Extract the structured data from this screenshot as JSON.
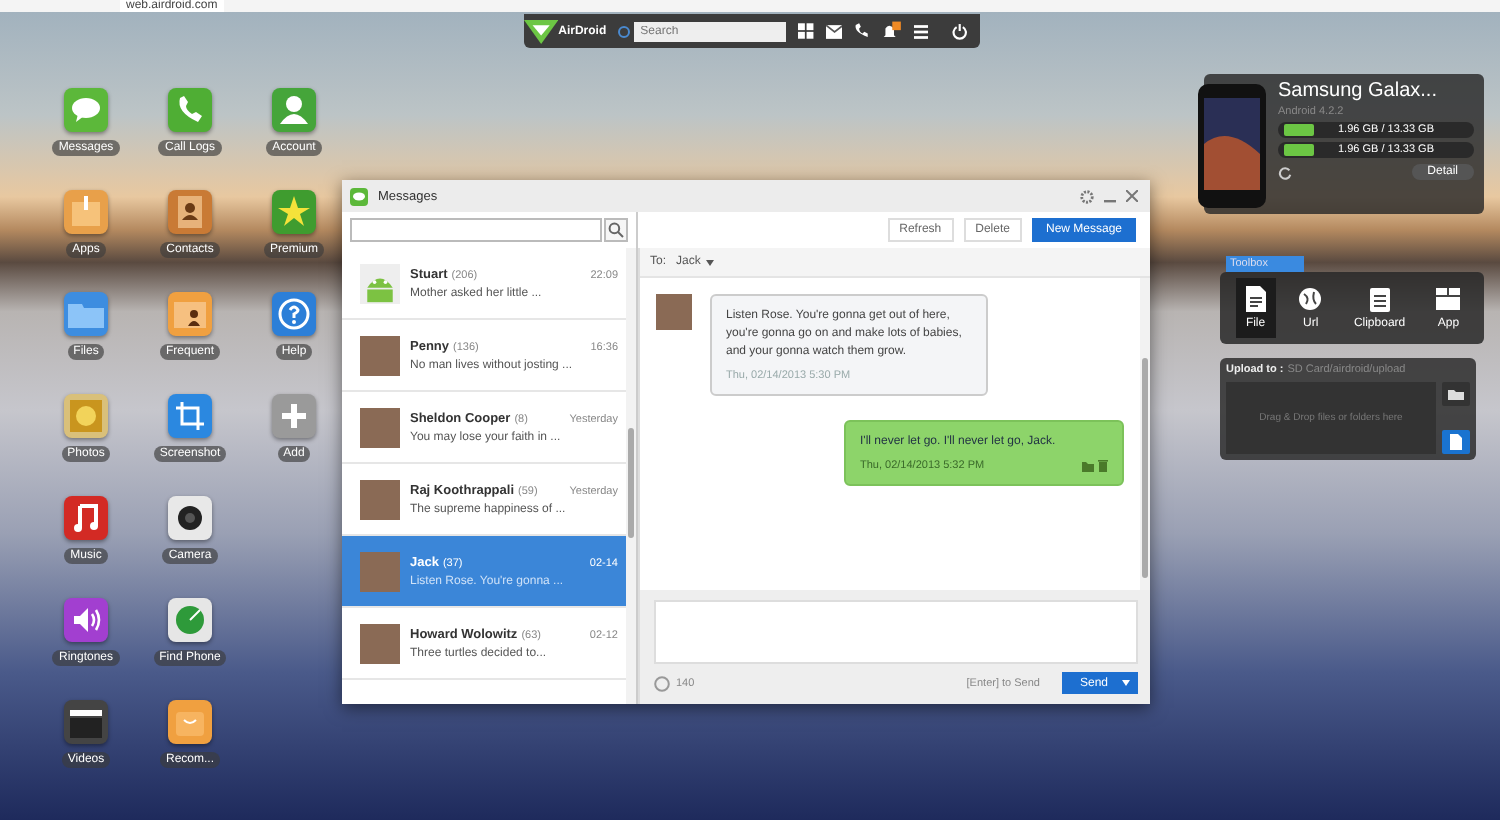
{
  "browser": {
    "url": "web.airdroid.com"
  },
  "top_bar": {
    "logo": "AirDroid",
    "search": {
      "placeholder": "Search"
    }
  },
  "desktop_icons": [
    {
      "label": "Messages",
      "kind": "messages"
    },
    {
      "label": "Apps",
      "kind": "apps"
    },
    {
      "label": "Files",
      "kind": "files"
    },
    {
      "label": "Photos",
      "kind": "photos"
    },
    {
      "label": "Music",
      "kind": "music"
    },
    {
      "label": "Ringtones",
      "kind": "ringtones"
    },
    {
      "label": "Videos",
      "kind": "videos"
    },
    {
      "label": "Call Logs",
      "kind": "calls"
    },
    {
      "label": "Contacts",
      "kind": "contacts"
    },
    {
      "label": "Frequent",
      "kind": "frequent"
    },
    {
      "label": "Screenshot",
      "kind": "screenshot"
    },
    {
      "label": "Camera",
      "kind": "camera"
    },
    {
      "label": "Find Phone",
      "kind": "findphone"
    },
    {
      "label": "Recom...",
      "kind": "recommend"
    },
    {
      "label": "Account",
      "kind": "account"
    },
    {
      "label": "Premium",
      "kind": "premium"
    },
    {
      "label": "Help",
      "kind": "help"
    },
    {
      "label": "Add",
      "kind": "add"
    }
  ],
  "messages_window": {
    "title": "Messages",
    "toolbar": [
      {
        "label": "Refresh",
        "primary": false
      },
      {
        "label": "Delete",
        "primary": false
      },
      {
        "label": "New Message",
        "primary": true
      }
    ],
    "conversations": [
      {
        "name": "Stuart",
        "count": "(206)",
        "time": "22:09",
        "preview": "Mother asked her little ...",
        "kind": "android",
        "selected": false
      },
      {
        "name": "Penny",
        "count": "(136)",
        "time": "16:36",
        "preview": "No man lives without josting ...",
        "kind": "photo",
        "selected": false
      },
      {
        "name": "Sheldon Cooper",
        "count": "(8)",
        "time": "Yesterday",
        "preview": "You may lose your faith in ...",
        "kind": "photo",
        "selected": false
      },
      {
        "name": "Raj Koothrappali",
        "count": "(59)",
        "time": "Yesterday",
        "preview": "The supreme happiness of ...",
        "kind": "photo",
        "selected": false
      },
      {
        "name": "Jack",
        "count": "(37)",
        "time": "02-14",
        "preview": "Listen Rose. You're gonna ...",
        "kind": "photo",
        "selected": true
      },
      {
        "name": "Howard Wolowitz",
        "count": "(63)",
        "time": "02-12",
        "preview": "Three turtles decided to...",
        "kind": "photo",
        "selected": false
      }
    ],
    "chat": {
      "to_label": "To:",
      "recipient": "Jack",
      "messages": [
        {
          "kind": "incoming",
          "text": "Listen Rose. You're gonna get out of here, you're gonna go on and make lots of babies, and your gonna watch them grow.",
          "time": "Thu, 02/14/2013 5:30 PM"
        },
        {
          "kind": "outgoing",
          "text": "I'll never let go. I'll never let go, Jack.",
          "time": "Thu, 02/14/2013 5:32 PM"
        }
      ],
      "char_count": "140",
      "hint": "[Enter] to Send",
      "send": "Send"
    }
  },
  "device": {
    "name": "Samsung Galax...",
    "version": "Android 4.2.2",
    "storage": [
      {
        "reading": "1.96 GB / 13.33 GB",
        "level": 0.15
      },
      {
        "reading": "1.96 GB / 13.33 GB",
        "level": 0.15
      }
    ],
    "detail": "Detail"
  },
  "toolbox": {
    "label": "Toolbox",
    "tools": [
      {
        "label": "File",
        "kind": "file",
        "selected": true
      },
      {
        "label": "Url",
        "kind": "url",
        "selected": false
      },
      {
        "label": "Clipboard",
        "kind": "clipboard",
        "selected": false
      },
      {
        "label": "App",
        "kind": "app",
        "selected": false
      }
    ],
    "upload_label": "Upload to :",
    "upload_path": "SD Card/airdroid/upload",
    "drop_hint": "Drag & Drop files or folders here"
  }
}
